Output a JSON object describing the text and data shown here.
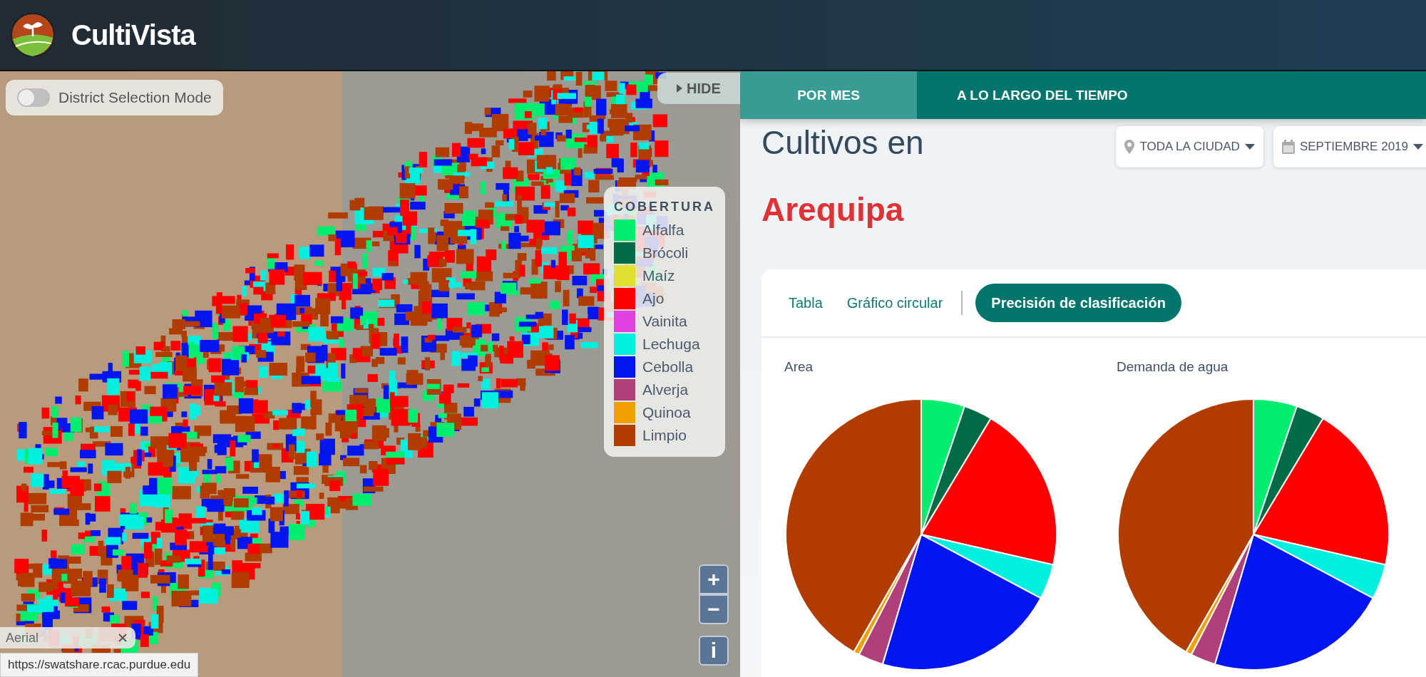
{
  "header": {
    "title": "CultiVista"
  },
  "map": {
    "district_toggle": {
      "label": "District Selection Mode",
      "on": false
    },
    "hide_button": "HIDE",
    "legend": {
      "title": "COBERTURA",
      "items": [
        {
          "label": "Alfalfa",
          "color": "#00ee6e"
        },
        {
          "label": "Brócoli",
          "color": "#006b45"
        },
        {
          "label": "Maíz",
          "color": "#e0e030"
        },
        {
          "label": "Ajo",
          "color": "#ff0000"
        },
        {
          "label": "Vainita",
          "color": "#e040e0"
        },
        {
          "label": "Lechuga",
          "color": "#00f0e0"
        },
        {
          "label": "Cebolla",
          "color": "#0015f0"
        },
        {
          "label": "Alverja",
          "color": "#b0407a"
        },
        {
          "label": "Quinoa",
          "color": "#f0a000"
        },
        {
          "label": "Limpio",
          "color": "#b03c00"
        }
      ]
    },
    "zoom_in": "+",
    "zoom_out": "−",
    "info": "i",
    "basemap": "Aerial",
    "status_url": "https://swatshare.rcac.purdue.edu"
  },
  "panel": {
    "tabs": [
      {
        "label": "POR MES",
        "selected": true
      },
      {
        "label": "A LO LARGO DEL TIEMPO",
        "selected": false
      }
    ],
    "heading": "Cultivos en",
    "place": "Arequipa",
    "dropdowns": [
      {
        "kind": "location",
        "label": "TODA LA CIUDAD"
      },
      {
        "kind": "date",
        "label": "SEPTIEMBRE 2019"
      }
    ],
    "view_tabs": [
      {
        "label": "Tabla",
        "selected": false
      },
      {
        "label": "Gráfico circular",
        "selected": false
      },
      {
        "label": "Precisión de clasificación",
        "selected": true
      }
    ],
    "charts": [
      {
        "title": "Area"
      },
      {
        "title": "Demanda de agua"
      }
    ]
  }
}
